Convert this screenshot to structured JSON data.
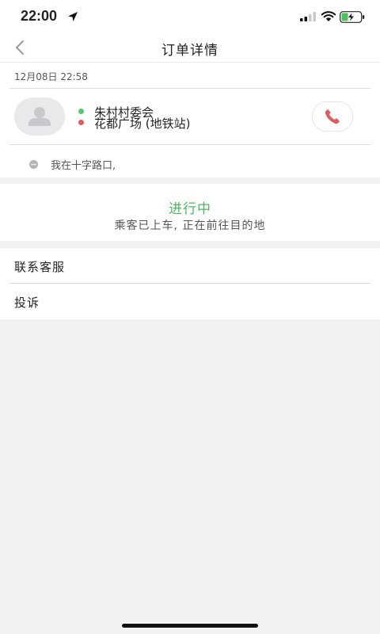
{
  "status_bar": {
    "time": "22:00",
    "icons": [
      "location-arrow-icon",
      "signal-icon",
      "wifi-icon",
      "battery-charging-icon"
    ]
  },
  "navbar": {
    "title": "订单详情",
    "back_icon": "chevron-left-icon"
  },
  "order": {
    "time": "12月08日 22:58",
    "start": "朱村村委会",
    "end": "花都广场 (地铁站)",
    "message": "我在十字路口,",
    "colors": {
      "start_dot": "#5cc86b",
      "end_dot": "#e45a5a",
      "phone": "#e05b5b"
    }
  },
  "status": {
    "main": "进行中",
    "sub": "乘客已上车, 正在前往目的地",
    "color": "#4cb860"
  },
  "menu": {
    "items": [
      {
        "label": "联系客服"
      },
      {
        "label": "投诉"
      }
    ]
  }
}
